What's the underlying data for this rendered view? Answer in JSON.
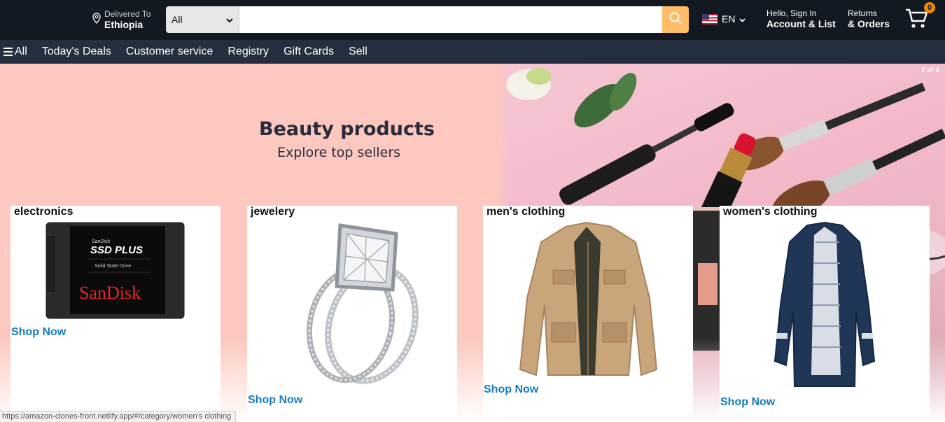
{
  "header": {
    "deliver_line1": "Delivered To",
    "deliver_line2": "Ethiopia",
    "search": {
      "category": "All",
      "value": "",
      "placeholder": ""
    },
    "language": "EN",
    "account_line1": "Hello, Sign In",
    "account_line2": "Account & List",
    "orders_line1": "Returns",
    "orders_line2": "& Orders",
    "cart_count": "0"
  },
  "nav": {
    "all": "All",
    "items": [
      "Today's Deals",
      "Customer service",
      "Registry",
      "Gift Cards",
      "Sell"
    ]
  },
  "hero": {
    "title": "Beauty products",
    "subtitle": "Explore top sellers",
    "counter": "2 of 4"
  },
  "categories": [
    {
      "title": "electronics",
      "link": "Shop Now"
    },
    {
      "title": "jewelery",
      "link": "Shop Now"
    },
    {
      "title": "men's clothing",
      "link": "Shop Now"
    },
    {
      "title": "women's clothing",
      "link": "Shop Now"
    }
  ],
  "product_text": {
    "brand_small": "SanDisk",
    "model": "SSD PLUS",
    "desc": "Solid State Drive",
    "brand": "SanDisk"
  },
  "status_url": "https://amazon-clones-front.netlify.app/#/category/women's clothing",
  "colors": {
    "topbar": "#131921",
    "navbar": "#232f3e",
    "search_button": "#febd69",
    "cart_badge": "#f08804",
    "link": "#147dbf",
    "hero_bg": "#fcc8bf"
  }
}
